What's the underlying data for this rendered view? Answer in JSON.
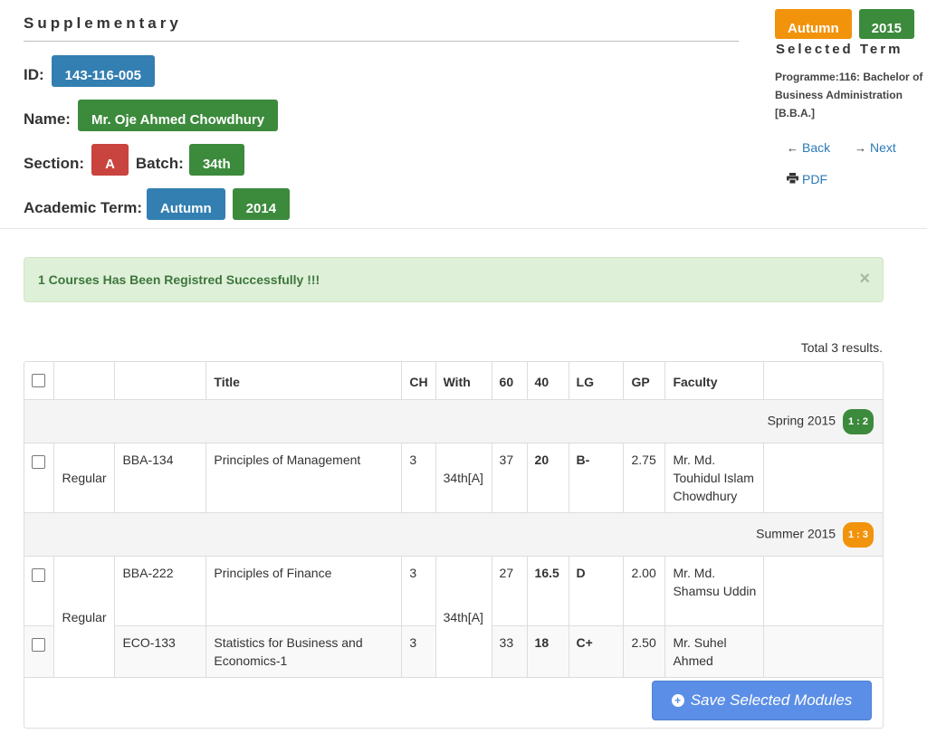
{
  "header": {
    "title": "Supplementary",
    "id_label": "ID:",
    "id_value": "143-116-005",
    "name_label": "Name:",
    "name_value": "Mr. Oje Ahmed Chowdhury",
    "section_label": "Section:",
    "section_value": "A",
    "batch_label": "Batch:",
    "batch_value": "34th",
    "academic_term_label": "Academic Term:",
    "academic_term_season": "Autumn",
    "academic_term_year": "2014"
  },
  "selected_term": {
    "season": "Autumn",
    "year": "2015",
    "label": "Selected Term",
    "programme": "Programme:116: Bachelor of Business Administration [B.B.A.]"
  },
  "nav": {
    "back_label": "Back",
    "next_label": "Next",
    "pdf_label": "PDF"
  },
  "alert": {
    "message": "1 Courses Has Been Registred Successfully !!!",
    "close": "×"
  },
  "results": {
    "total_text": "Total 3 results."
  },
  "table": {
    "columns": [
      "",
      "",
      "",
      "Title",
      "CH",
      "With",
      "60",
      "40",
      "LG",
      "GP",
      "Faculty",
      ""
    ],
    "groups": [
      {
        "term": "Spring 2015",
        "badge": "1 : 2",
        "badge_color": "#3c8a3c",
        "type": "Regular",
        "with": "34th[A]",
        "rows": [
          {
            "code": "BBA-134",
            "title": "Principles of Management",
            "ch": "3",
            "m60": "37",
            "m40": "20",
            "lg": "B-",
            "gp": "2.75",
            "faculty": "Mr. Md. Touhidul Islam Chowdhury"
          }
        ]
      },
      {
        "term": "Summer 2015",
        "badge": "1 : 3",
        "badge_color": "#f2930c",
        "type": "Regular",
        "with": "34th[A]",
        "rows": [
          {
            "code": "BBA-222",
            "title": "Principles of Finance",
            "ch": "3",
            "m60": "27",
            "m40": "16.5",
            "lg": "D",
            "gp": "2.00",
            "faculty": "Mr. Md. Shamsu Uddin"
          },
          {
            "code": "ECO-133",
            "title": "Statistics for Business and Economics-1",
            "ch": "3",
            "m60": "33",
            "m40": "18",
            "lg": "C+",
            "gp": "2.50",
            "faculty": "Mr. Suhel Ahmed"
          }
        ]
      }
    ]
  },
  "save_button_label": "Save Selected Modules",
  "colors": {
    "blue": "#337fb2",
    "green": "#3c8a3c",
    "red": "#c9433f",
    "orange": "#f2930c",
    "save_button": "#5b8ee6",
    "alert_bg": "#dff0d8"
  }
}
